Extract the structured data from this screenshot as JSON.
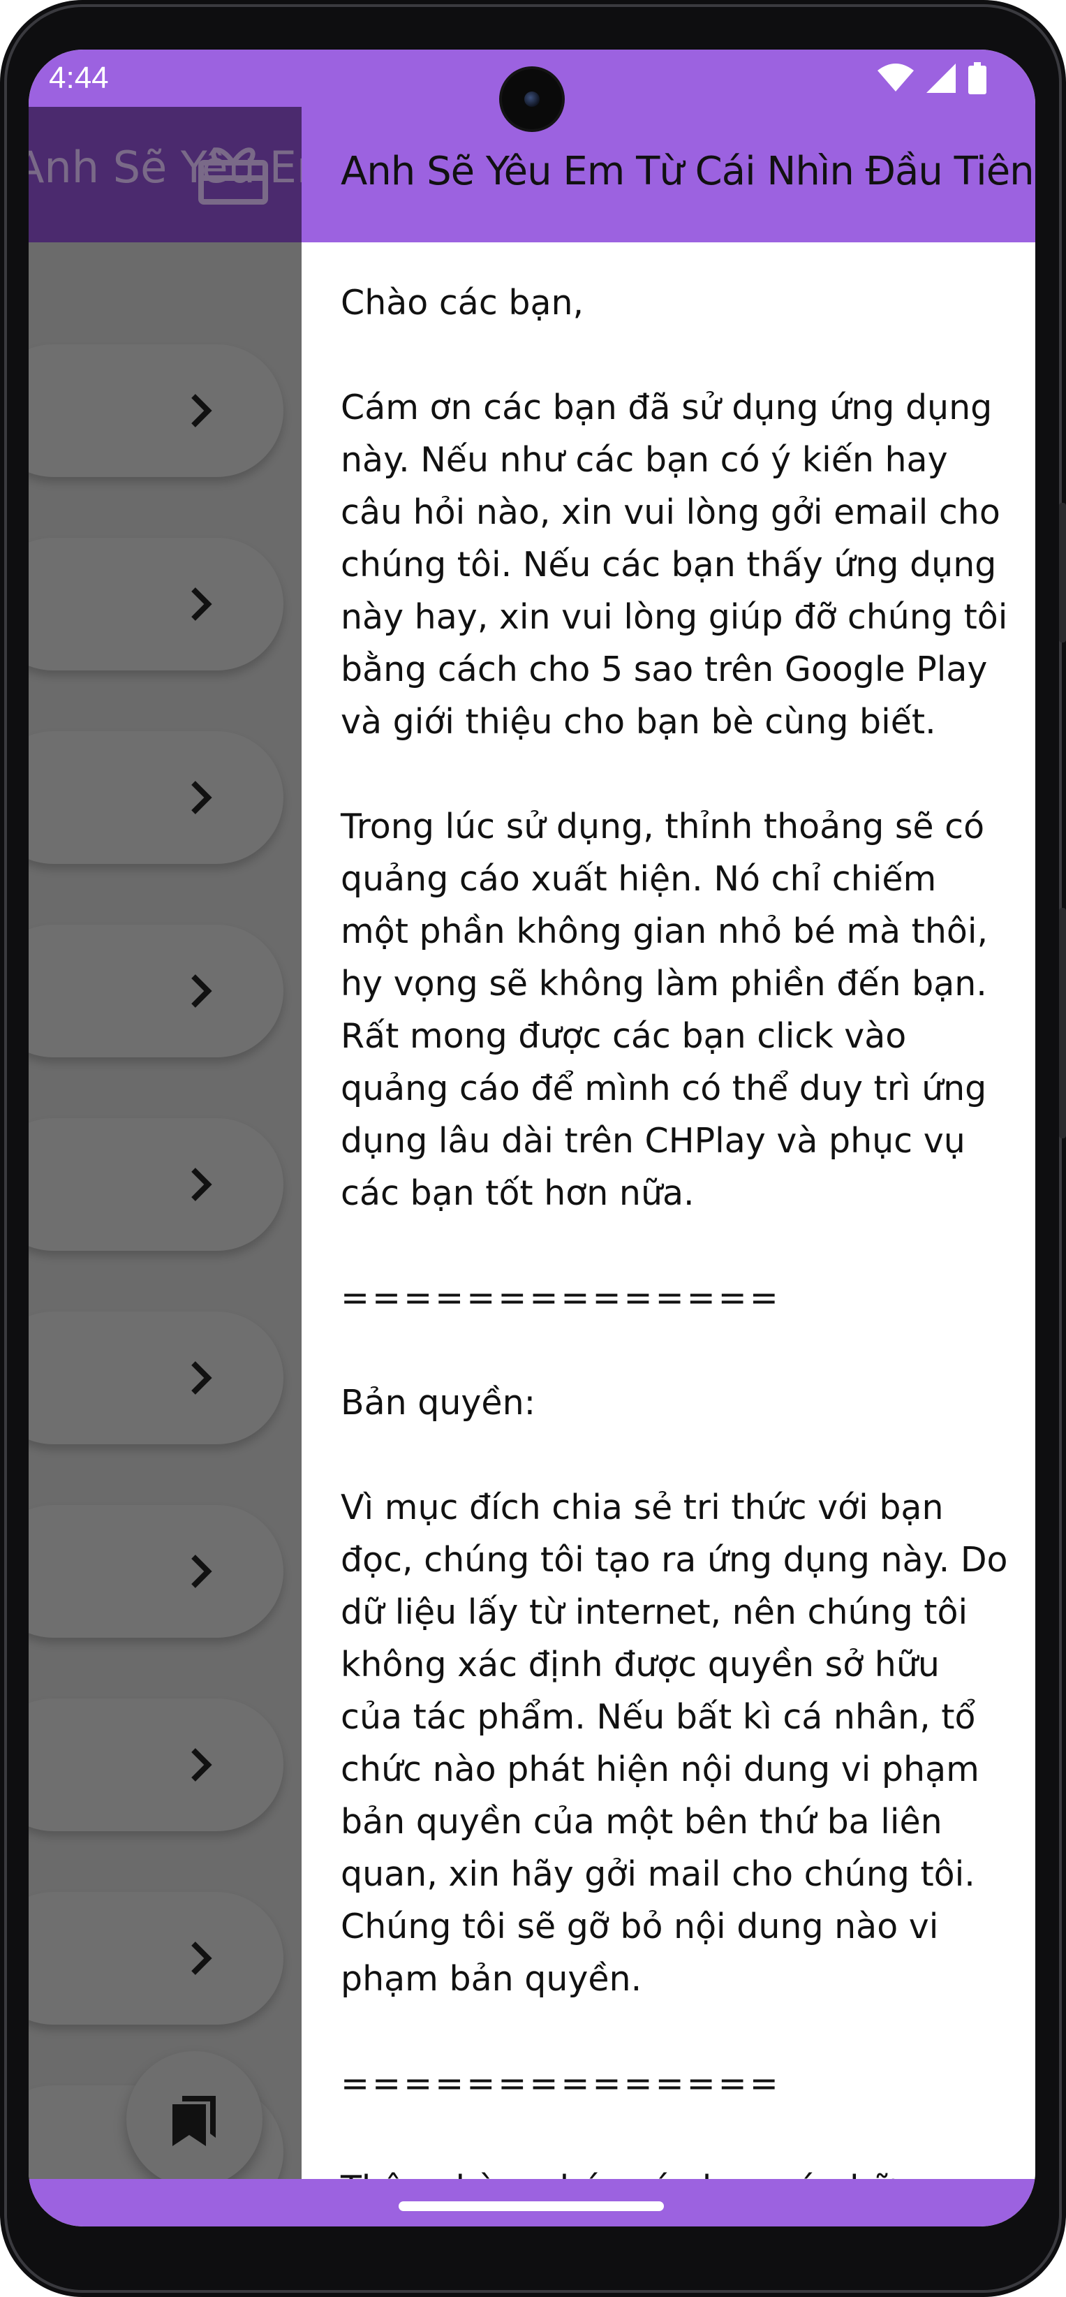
{
  "status_bar": {
    "time": "4:44"
  },
  "drawer": {
    "title": "Anh Sẽ Yêu Em Từ Cái Nhìn Đầu Tiên",
    "header_color": "#4b2a6e",
    "gift_icon": "gift-icon",
    "item_count": 9,
    "chevron_icon": "chevron-right-icon",
    "fab_icon": "bookmarks-icon"
  },
  "app_bar": {
    "title": "Anh Sẽ Yêu Em Từ Cái Nhìn Đầu Tiên",
    "color": "#9c62e0"
  },
  "article": {
    "greeting": "Chào các bạn,",
    "paragraph_1": "Cám ơn các bạn đã sử dụng ứng dụng này. Nếu như các bạn có ý kiến hay câu hỏi nào, xin vui lòng gởi email cho chúng tôi. Nếu các bạn thấy ứng dụng này hay, xin vui lòng giúp đỡ chúng tôi bằng cách cho 5 sao trên Google Play và giới thiệu cho bạn bè cùng biết.",
    "paragraph_2": "Trong lúc sử dụng, thỉnh thoảng sẽ có quảng cáo xuất hiện. Nó chỉ chiếm một phần không gian nhỏ bé mà thôi, hy vọng sẽ không làm phiền đến bạn. Rất mong được các bạn click vào quảng cáo để mình có thể duy trì ứng dụng lâu dài trên CHPlay và phục vụ các bạn tốt hơn nữa.",
    "divider_1": "==============",
    "copyright_heading": "Bản quyền:",
    "paragraph_3": "Vì mục đích chia sẻ tri thức với bạn đọc, chúng tôi tạo ra ứng dụng này. Do dữ liệu lấy từ internet, nên chúng tôi không xác định được quyền sở hữu của tác phẩm. Nếu bất kì cá nhân, tổ chức nào phát hiện nội dung vi phạm bản quyền của một bên thứ ba liên quan, xin hãy gởi mail cho chúng tôi. Chúng tôi sẽ gỡ bỏ nội dung nào vi phạm bản quyền.",
    "divider_2": "==============",
    "closing": "Thân chào, chúc các bạn có những giây"
  }
}
